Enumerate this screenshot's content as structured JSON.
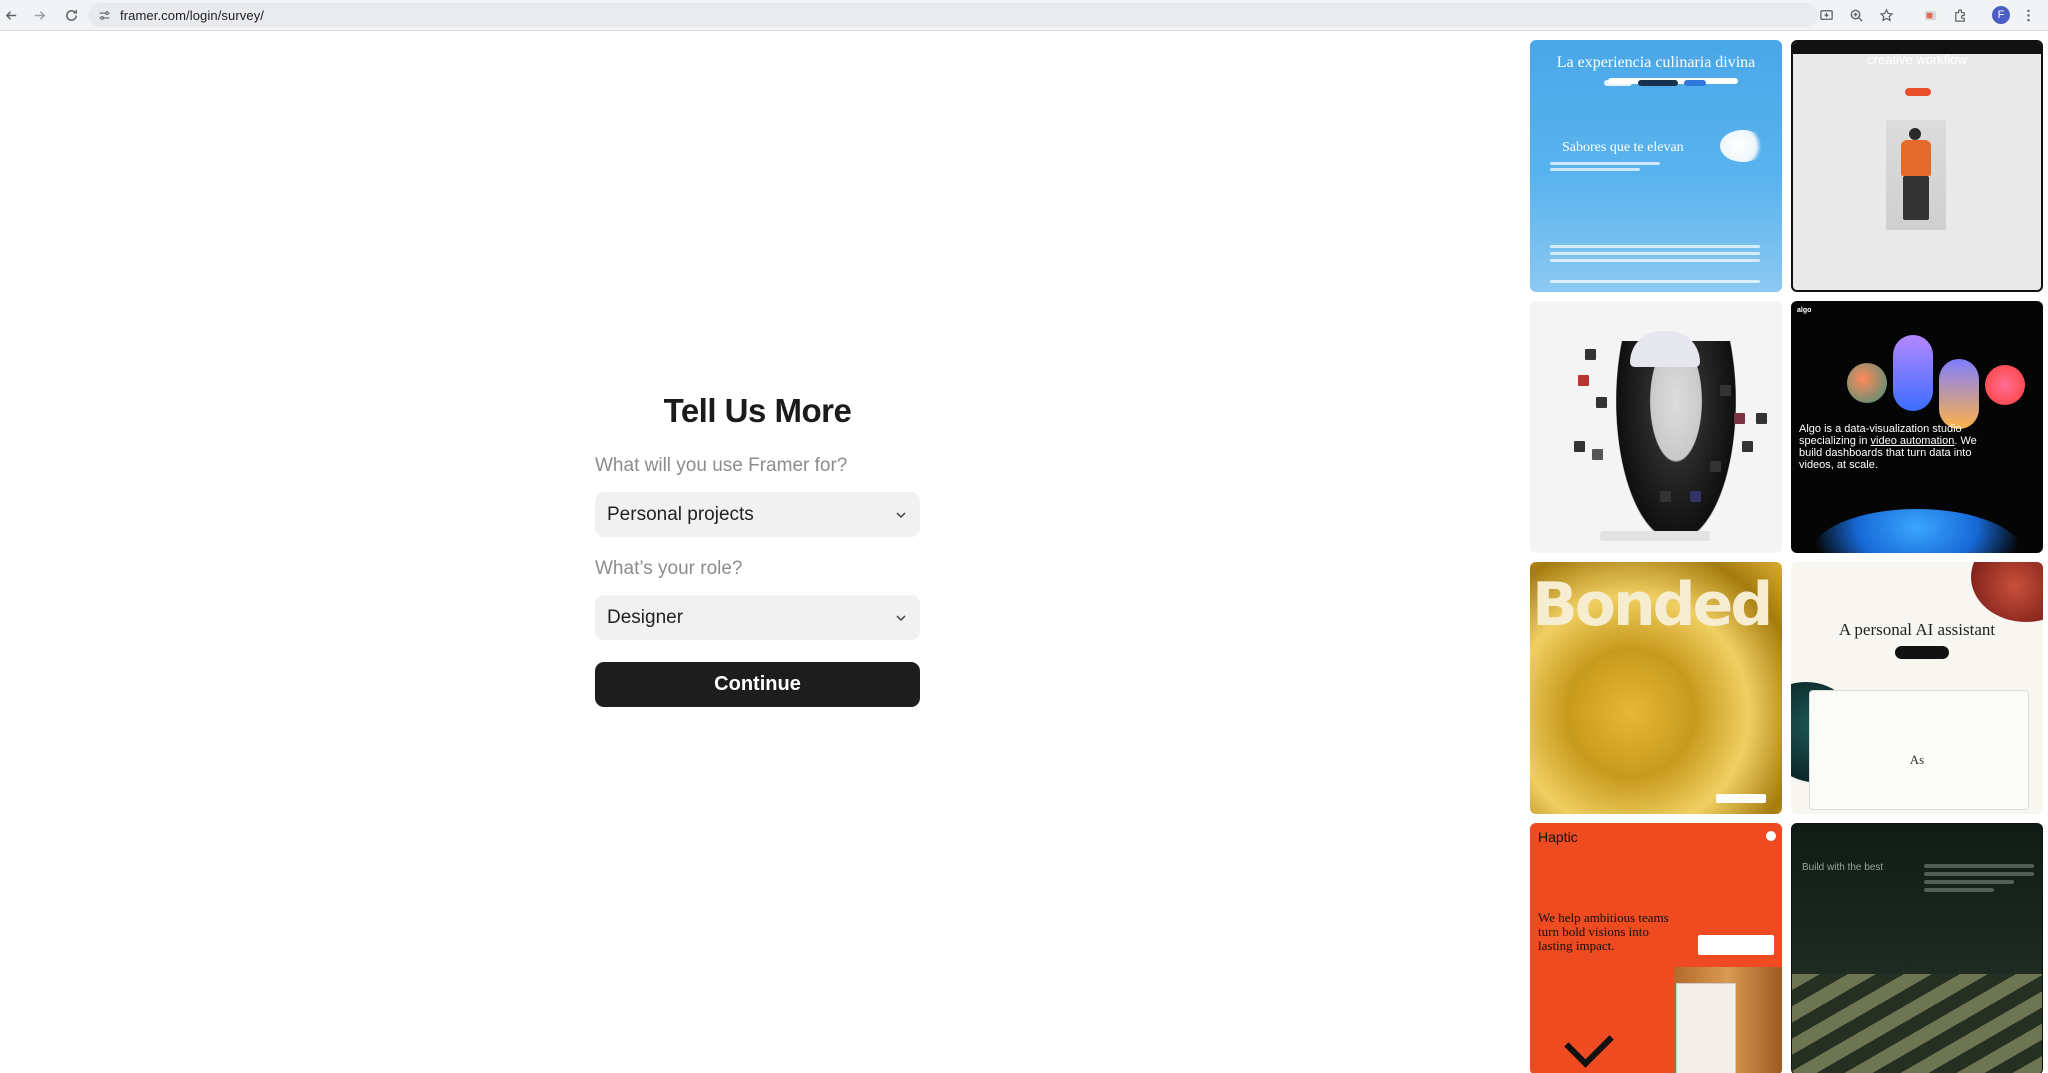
{
  "browser": {
    "url": "framer.com/login/survey/",
    "profile_initial": "F"
  },
  "survey": {
    "title": "Tell Us More",
    "use_label": "What will you use Framer for?",
    "use_value": "Personal projects",
    "role_label": "What’s your role?",
    "role_value": "Designer",
    "continue_label": "Continue"
  },
  "gallery": {
    "tile1": {
      "headline": "La experiencia culinaria divina",
      "subhead": "Sabores que te elevan"
    },
    "tile2": {
      "headline": "creative workflow"
    },
    "tile4": {
      "logo": "algo",
      "text_before": "Algo is a data-visualization studio specializing in ",
      "link": "video automation",
      "text_after": ". We build dashboards that turn data into videos, at scale."
    },
    "tile5": {
      "word": "Bonded"
    },
    "tile6": {
      "headline": "A personal AI assistant",
      "window_text": "As"
    },
    "tile7": {
      "logo": "Haptic",
      "claim": "We help ambitious teams turn bold visions into lasting impact."
    },
    "tile8": {
      "headline": "Build with the best"
    }
  },
  "colors": {
    "button_bg": "#1d1d1d",
    "select_bg": "#f1f1f1",
    "label_gray": "#8c8c8c"
  }
}
